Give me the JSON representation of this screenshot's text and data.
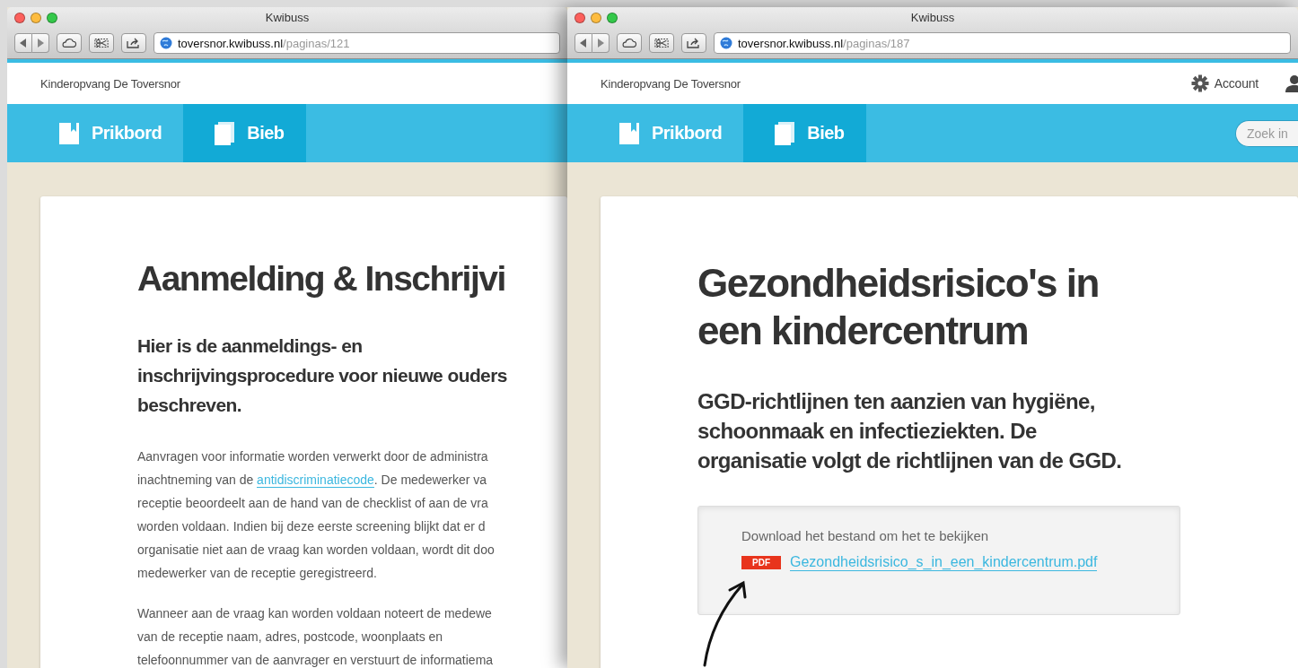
{
  "windows": [
    {
      "title": "Kwibuss",
      "url_host": "toversnor.kwibuss.nl",
      "url_path": "/paginas/121",
      "site_name": "Kinderopvang De Toversnor",
      "nav": [
        {
          "label": "Prikbord",
          "selected": false
        },
        {
          "label": "Bieb",
          "selected": true
        }
      ],
      "page": {
        "heading": "Aanmelding & Inschrijvi",
        "subtitle_lines": [
          "Hier is de aanmeldings- en",
          "inschrijvingsprocedure voor nieuwe ouders",
          "beschreven."
        ],
        "paragraphs": [
          [
            {
              "text": "Aanvragen voor informatie worden verwerkt door de administra"
            },
            {
              "text": "inachtneming van de ",
              "link": "antidiscriminatiecode",
              "after": ". De medewerker va"
            },
            {
              "text": "receptie beoordeelt aan de hand van de checklist of aan de vra"
            },
            {
              "text": "worden voldaan. Indien bij deze eerste screening blijkt dat er d"
            },
            {
              "text": "organisatie niet aan de vraag kan worden voldaan, wordt dit doo"
            },
            {
              "text": "medewerker van de receptie geregistreerd."
            }
          ],
          [
            {
              "text": "Wanneer aan de vraag kan worden voldaan noteert de medewe"
            },
            {
              "text": "van de receptie naam, adres, postcode, woonplaats en"
            },
            {
              "text": "telefoonnummer van de aanvrager en verstuurt de informatiema"
            }
          ]
        ]
      }
    },
    {
      "title": "Kwibuss",
      "url_host": "toversnor.kwibuss.nl",
      "url_path": "/paginas/187",
      "site_name": "Kinderopvang De Toversnor",
      "account": "Account",
      "search": {
        "placeholder": "Zoek in"
      },
      "nav": [
        {
          "label": "Prikbord",
          "selected": false
        },
        {
          "label": "Bieb",
          "selected": true
        }
      ],
      "page": {
        "heading": "Gezondheidsrisico's in een kindercentrum",
        "subtitle": "GGD-richtlijnen ten aanzien van hygiëne, schoonmaak en infectieziekten. De organisatie volgt de richtlijnen van de GGD.",
        "download": {
          "prompt": "Download het bestand om het te bekijken",
          "file_type": "PDF",
          "file_name": "Gezondheidsrisico_s_in_een_kindercentrum.pdf"
        }
      }
    }
  ]
}
